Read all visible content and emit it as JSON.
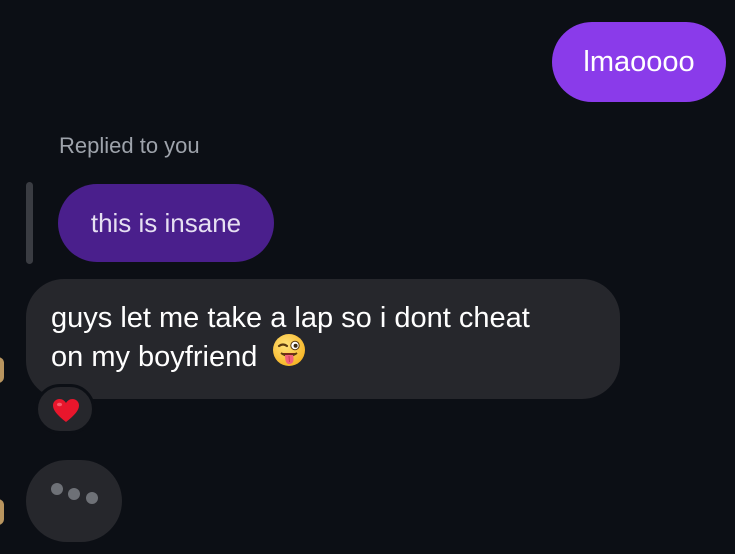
{
  "messages": {
    "sent_text": "lmaoooo",
    "reply_label": "Replied to you",
    "quoted_text": "this is insane",
    "received_line1": "guys let me take a lap so i dont cheat",
    "received_line2": "on my boyfriend"
  },
  "icons": {
    "reaction": "red-heart-icon",
    "emoji": "winking-face-with-tongue-icon"
  },
  "colors": {
    "sent_bubble": "#8a3bea",
    "quoted_bubble": "#4a1f8c",
    "received_bubble": "#26272c",
    "background": "#0c0f15"
  }
}
